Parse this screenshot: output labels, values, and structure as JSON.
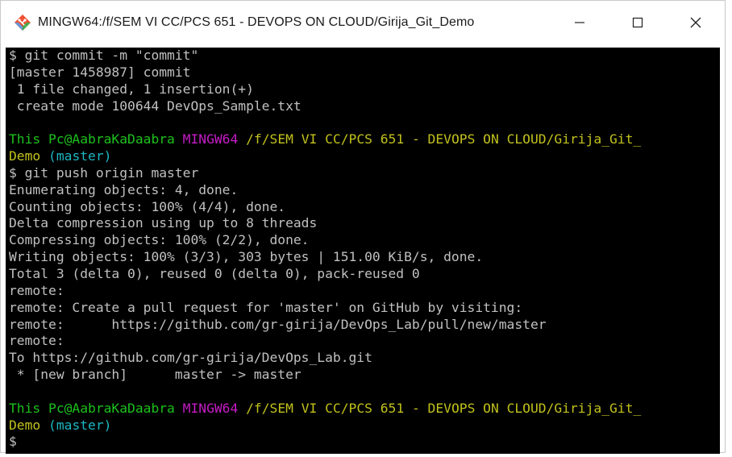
{
  "window": {
    "title": "MINGW64:/f/SEM VI CC/PCS 651 - DEVOPS ON CLOUD/Girija_Git_Demo",
    "icon": "git-bash-icon",
    "controls": {
      "minimize": "minimize-icon",
      "maximize": "maximize-icon",
      "close": "close-icon"
    }
  },
  "colors": {
    "background": "#000000",
    "text": "#c0c0c0",
    "user_host": "#1cc11c",
    "shell": "#c61cc6",
    "path": "#c1c11c",
    "branch": "#1cb6c1"
  },
  "terminal": {
    "lines": [
      {
        "segments": [
          {
            "text": "$ git commit -m \"commit\"",
            "color": "gray"
          }
        ]
      },
      {
        "segments": [
          {
            "text": "[master 1458987] commit",
            "color": "gray"
          }
        ]
      },
      {
        "segments": [
          {
            "text": " 1 file changed, 1 insertion(+)",
            "color": "gray"
          }
        ]
      },
      {
        "segments": [
          {
            "text": " create mode 100644 DevOps_Sample.txt",
            "color": "gray"
          }
        ]
      },
      {
        "segments": []
      },
      {
        "segments": [
          {
            "text": "This Pc@AabraKaDaabra",
            "color": "green"
          },
          {
            "text": " ",
            "color": "gray"
          },
          {
            "text": "MINGW64",
            "color": "magenta"
          },
          {
            "text": " ",
            "color": "gray"
          },
          {
            "text": "/f/SEM VI CC/PCS 651 - DEVOPS ON CLOUD/Girija_Git_",
            "color": "yellow"
          }
        ]
      },
      {
        "segments": [
          {
            "text": "Demo",
            "color": "yellow"
          },
          {
            "text": " ",
            "color": "gray"
          },
          {
            "text": "(master)",
            "color": "cyan"
          }
        ]
      },
      {
        "segments": [
          {
            "text": "$ git push origin master",
            "color": "gray"
          }
        ]
      },
      {
        "segments": [
          {
            "text": "Enumerating objects: 4, done.",
            "color": "gray"
          }
        ]
      },
      {
        "segments": [
          {
            "text": "Counting objects: 100% (4/4), done.",
            "color": "gray"
          }
        ]
      },
      {
        "segments": [
          {
            "text": "Delta compression using up to 8 threads",
            "color": "gray"
          }
        ]
      },
      {
        "segments": [
          {
            "text": "Compressing objects: 100% (2/2), done.",
            "color": "gray"
          }
        ]
      },
      {
        "segments": [
          {
            "text": "Writing objects: 100% (3/3), 303 bytes | 151.00 KiB/s, done.",
            "color": "gray"
          }
        ]
      },
      {
        "segments": [
          {
            "text": "Total 3 (delta 0), reused 0 (delta 0), pack-reused 0",
            "color": "gray"
          }
        ]
      },
      {
        "segments": [
          {
            "text": "remote:",
            "color": "gray"
          }
        ]
      },
      {
        "segments": [
          {
            "text": "remote: Create a pull request for 'master' on GitHub by visiting:",
            "color": "gray"
          }
        ]
      },
      {
        "segments": [
          {
            "text": "remote:      https://github.com/gr-girija/DevOps_Lab/pull/new/master",
            "color": "gray"
          }
        ]
      },
      {
        "segments": [
          {
            "text": "remote:",
            "color": "gray"
          }
        ]
      },
      {
        "segments": [
          {
            "text": "To https://github.com/gr-girija/DevOps_Lab.git",
            "color": "gray"
          }
        ]
      },
      {
        "segments": [
          {
            "text": " * [new branch]      master -> master",
            "color": "gray"
          }
        ]
      },
      {
        "segments": []
      },
      {
        "segments": [
          {
            "text": "This Pc@AabraKaDaabra",
            "color": "green"
          },
          {
            "text": " ",
            "color": "gray"
          },
          {
            "text": "MINGW64",
            "color": "magenta"
          },
          {
            "text": " ",
            "color": "gray"
          },
          {
            "text": "/f/SEM VI CC/PCS 651 - DEVOPS ON CLOUD/Girija_Git_",
            "color": "yellow"
          }
        ]
      },
      {
        "segments": [
          {
            "text": "Demo",
            "color": "yellow"
          },
          {
            "text": " ",
            "color": "gray"
          },
          {
            "text": "(master)",
            "color": "cyan"
          }
        ]
      },
      {
        "segments": [
          {
            "text": "$",
            "color": "gray"
          }
        ]
      }
    ]
  }
}
